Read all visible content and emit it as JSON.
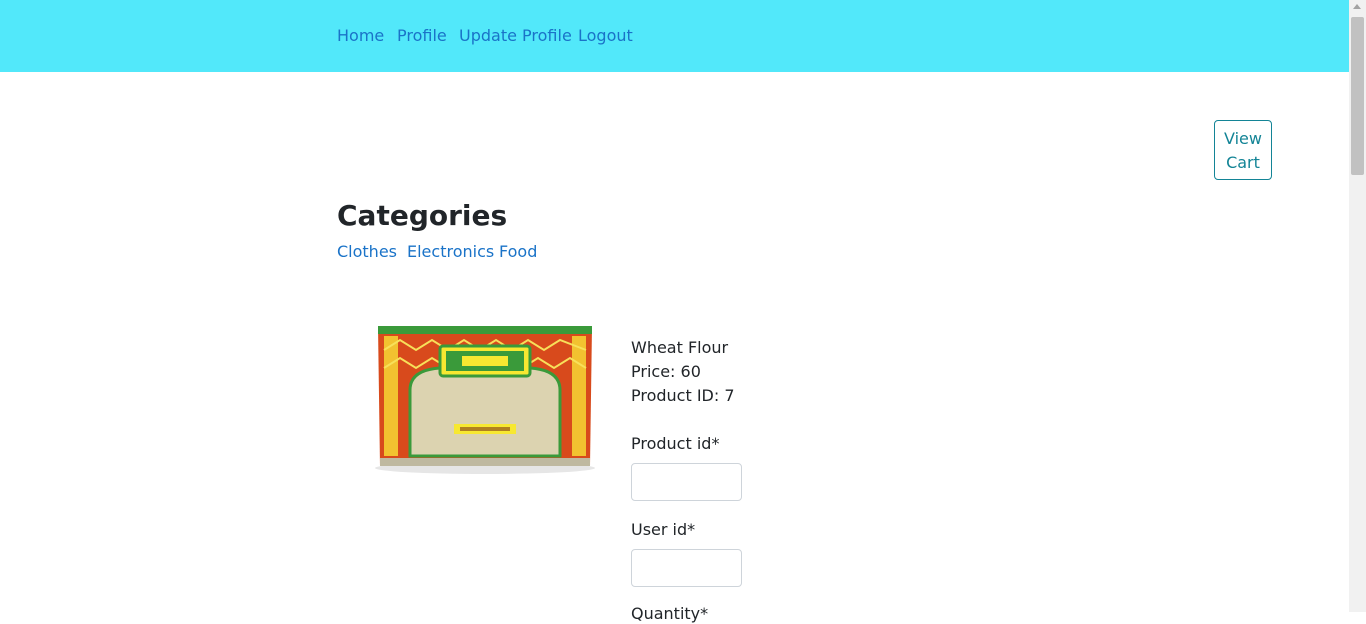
{
  "nav": {
    "items": [
      {
        "label": "Home"
      },
      {
        "label": "Profile"
      },
      {
        "label": "Update Profile"
      },
      {
        "label": "Logout"
      }
    ]
  },
  "cart": {
    "button_line1": "View",
    "button_line2": "Cart"
  },
  "categories": {
    "heading": "Categories",
    "items": [
      {
        "label": "Clothes"
      },
      {
        "label": "Electronics"
      },
      {
        "label": "Food"
      }
    ]
  },
  "product": {
    "name": "Wheat Flour",
    "price": "Price: 60",
    "product_id": "Product ID: 7",
    "image_icon": "flour-package-image"
  },
  "form": {
    "product_id_label": "Product id*",
    "product_id_value": "",
    "user_id_label": "User id*",
    "user_id_value": "",
    "quantity_label": "Quantity*"
  },
  "colors": {
    "navbar": "#52e8fa",
    "link": "#1a73c8",
    "cart_border": "#138496"
  }
}
